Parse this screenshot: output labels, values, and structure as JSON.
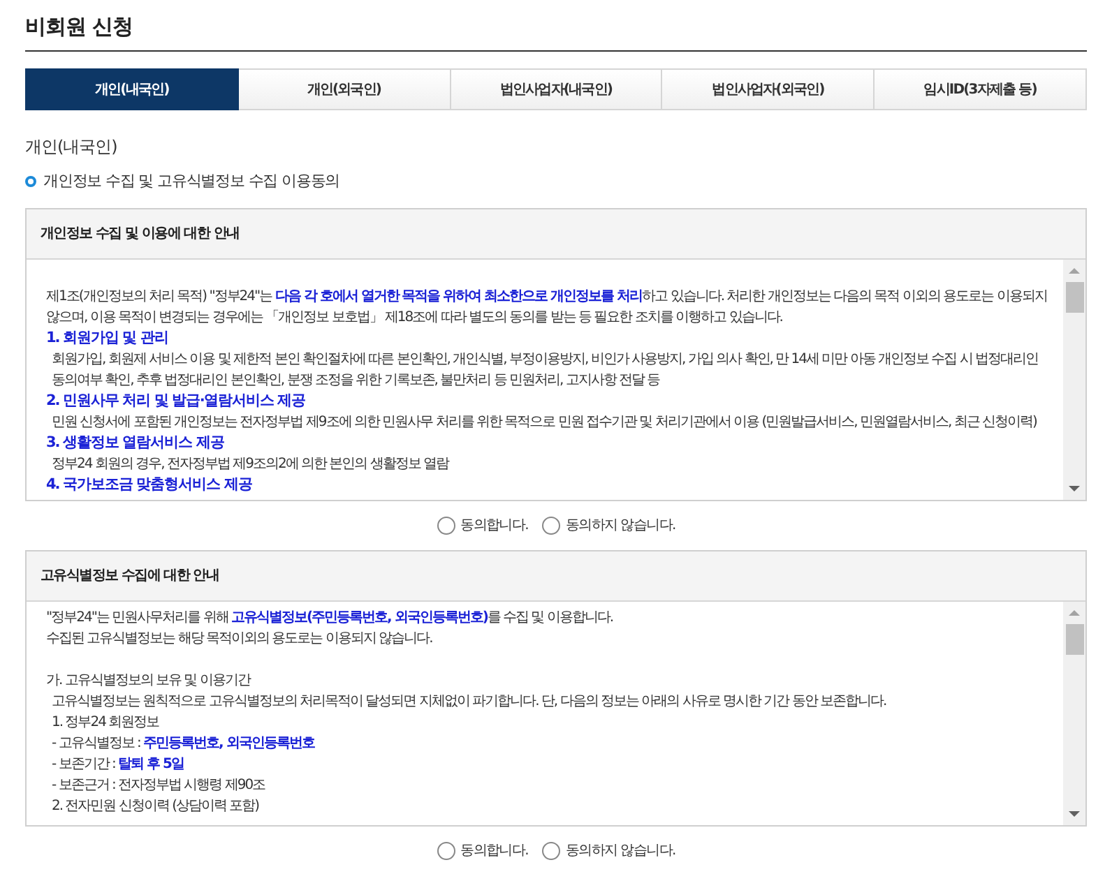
{
  "title": "비회원 신청",
  "tabs": [
    {
      "label": "개인(내국인)",
      "selected": true
    },
    {
      "label": "개인(외국인)",
      "selected": false
    },
    {
      "label": "법인사업자(내국인)",
      "selected": false
    },
    {
      "label": "법인사업자(외국인)",
      "selected": false
    },
    {
      "label": "임시ID(3자제출 등)",
      "selected": false
    }
  ],
  "section_title": "개인(내국인)",
  "subsection_title": "개인정보 수집 및 고유식별정보 수집 이용동의",
  "panels": [
    {
      "heading": "개인정보 수집 및 이용에 대한 안내",
      "lines": [
        {
          "kind": "blank"
        },
        {
          "kind": "text",
          "text": "제1조(개인정보의 처리 목적) \"정부24\"는 **다음 각 호에서 열거한 목적을 위하여 최소한으로 개인정보를 처리**하고 있습니다. 처리한 개인정보는 다음의 목적 이외의 용도로는 이용되지 않으며, 이용 목적이 변경되는 경우에는 「개인정보 보호법」 제18조에 따라 별도의 동의를 받는 등 필요한 조치를 이행하고 있습니다."
        },
        {
          "kind": "heading",
          "text": "1. 회원가입 및 관리"
        },
        {
          "kind": "sub",
          "text": "회원가입, 회원제 서비스 이용 및 제한적 본인 확인절차에 따른 본인확인, 개인식별, 부정이용방지, 비인가 사용방지, 가입 의사 확인, 만 14세 미만 아동 개인정보 수집 시 법정대리인 동의여부 확인, 추후 법정대리인 본인확인, 분쟁 조정을 위한 기록보존, 불만처리 등 민원처리, 고지사항 전달 등"
        },
        {
          "kind": "heading",
          "text": "2. 민원사무 처리 및 발급·열람서비스 제공"
        },
        {
          "kind": "sub",
          "text": "민원 신청서에 포함된 개인정보는 전자정부법 제9조에 의한 민원사무 처리를 위한 목적으로 민원 접수기관 및 처리기관에서 이용 (민원발급서비스, 민원열람서비스, 최근 신청이력)"
        },
        {
          "kind": "heading",
          "text": "3. 생활정보 열람서비스 제공"
        },
        {
          "kind": "sub",
          "text": "정부24 회원의 경우, 전자정부법 제9조의2에 의한 본인의 생활정보 열람"
        },
        {
          "kind": "heading",
          "text": "4. 국가보조금 맞춤형서비스 제공"
        }
      ],
      "consent": [
        {
          "label": "동의합니다.",
          "selected": false
        },
        {
          "label": "동의하지 않습니다.",
          "selected": false
        }
      ]
    },
    {
      "heading": "고유식별정보 수집에 대한 안내",
      "lines": [
        {
          "kind": "text",
          "text": "\"정부24\"는 민원사무처리를 위해 **고유식별정보(주민등록번호, 외국인등록번호)**를 수집 및 이용합니다."
        },
        {
          "kind": "text",
          "text": "수집된 고유식별정보는 해당 목적이외의 용도로는 이용되지 않습니다."
        },
        {
          "kind": "blank"
        },
        {
          "kind": "text",
          "text": "가. 고유식별정보의 보유 및 이용기간"
        },
        {
          "kind": "sub",
          "text": "고유식별정보는 원칙적으로 고유식별정보의 처리목적이 달성되면 지체없이 파기합니다. 단, 다음의 정보는 아래의 사유로 명시한 기간 동안 보존합니다."
        },
        {
          "kind": "sub",
          "text": "1. 정부24 회원정보"
        },
        {
          "kind": "sub",
          "text": "- 고유식별정보 : **주민등록번호, 외국인등록번호**"
        },
        {
          "kind": "sub",
          "text": "- 보존기간 : **탈퇴 후 5일**"
        },
        {
          "kind": "sub",
          "text": "- 보존근거 : 전자정부법 시행령 제90조"
        },
        {
          "kind": "sub",
          "text": "2. 전자민원 신청이력 (상담이력 포함)"
        }
      ],
      "consent": [
        {
          "label": "동의합니다.",
          "selected": false
        },
        {
          "label": "동의하지 않습니다.",
          "selected": false
        }
      ]
    }
  ]
}
